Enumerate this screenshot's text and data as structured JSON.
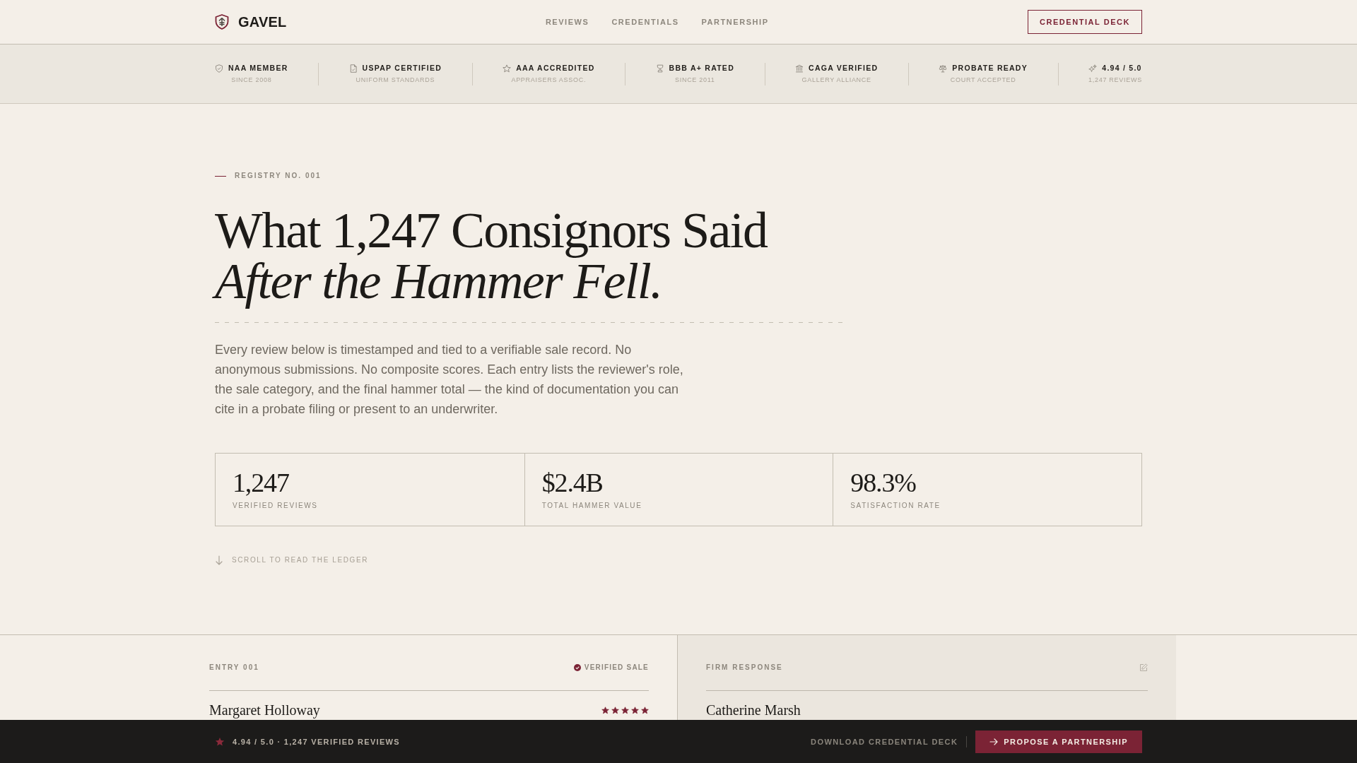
{
  "header": {
    "brand": "GAVEL",
    "nav": [
      "REVIEWS",
      "CREDENTIALS",
      "PARTNERSHIP"
    ],
    "button": "CREDENTIAL DECK"
  },
  "credentials": [
    {
      "title": "NAA MEMBER",
      "subtitle": "SINCE 2008"
    },
    {
      "title": "USPAP CERTIFIED",
      "subtitle": "UNIFORM STANDARDS"
    },
    {
      "title": "AAA ACCREDITED",
      "subtitle": "APPRAISERS ASSOC."
    },
    {
      "title": "BBB A+ RATED",
      "subtitle": "SINCE 2011"
    },
    {
      "title": "CAGA VERIFIED",
      "subtitle": "GALLERY ALLIANCE"
    },
    {
      "title": "PROBATE READY",
      "subtitle": "COURT ACCEPTED"
    },
    {
      "title": "4.94 / 5.0",
      "subtitle": "1,247 REVIEWS"
    }
  ],
  "hero": {
    "eyebrow": "REGISTRY NO. 001",
    "headline": "What 1,247 Consignors Said",
    "headline_italic": "After the Hammer Fell.",
    "intro": "Every review below is timestamped and tied to a verifiable sale record. No anonymous submissions. No composite scores. Each entry lists the reviewer's role, the sale category, and the final hammer total — the kind of documentation you can cite in a probate filing or present to an underwriter."
  },
  "stats": [
    {
      "value": "1,247",
      "label": "VERIFIED REVIEWS"
    },
    {
      "value": "$2.4B",
      "label": "TOTAL HAMMER VALUE"
    },
    {
      "value": "98.3%",
      "label": "SATISFACTION RATE"
    }
  ],
  "scroll_hint": "SCROLL TO READ THE LEDGER",
  "entry": {
    "label": "ENTRY 001",
    "badge": "VERIFIED SALE",
    "reviewer": "Margaret Holloway",
    "stars": 5
  },
  "response": {
    "label": "FIRM RESPONSE",
    "responder": "Catherine Marsh"
  },
  "bottom_bar": {
    "rating": "4.94 / 5.0 · 1,247 VERIFIED REVIEWS",
    "link": "DOWNLOAD CREDENTIAL DECK",
    "button": "PROPOSE A PARTNERSHIP"
  }
}
